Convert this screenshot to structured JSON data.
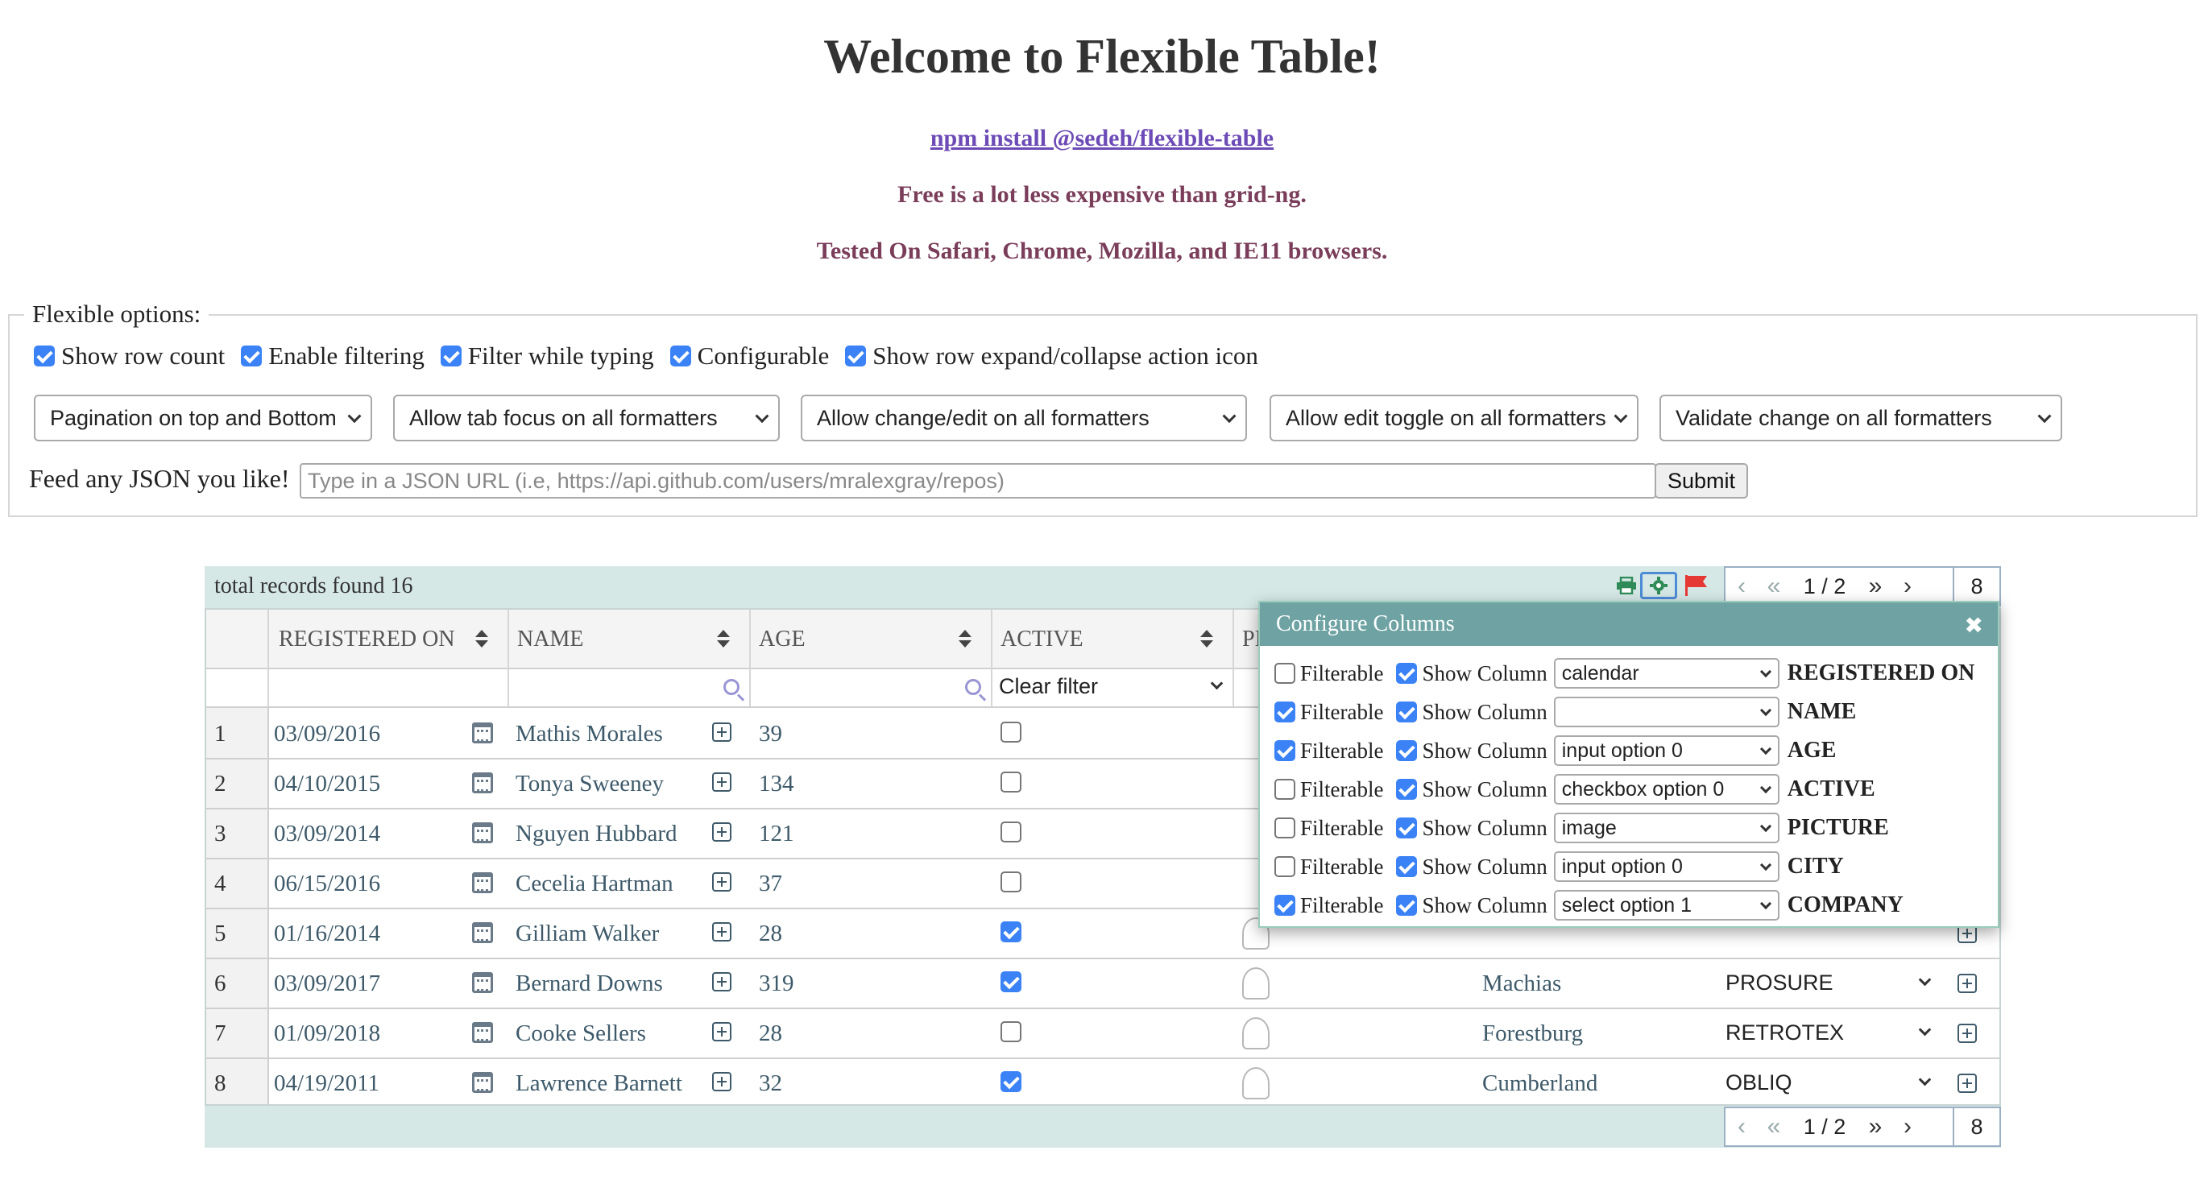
{
  "header": {
    "title": "Welcome to Flexible Table!",
    "install_link": "npm install @sedeh/flexible-table",
    "tagline1": "Free is a lot less expensive than grid-ng.",
    "tagline2": "Tested On Safari, Chrome, Mozilla, and IE11 browsers."
  },
  "options": {
    "legend": "Flexible options:",
    "checkboxes": [
      {
        "label": "Show row count",
        "checked": true
      },
      {
        "label": "Enable filtering",
        "checked": true
      },
      {
        "label": "Filter while typing",
        "checked": true
      },
      {
        "label": "Configurable",
        "checked": true
      },
      {
        "label": "Show row expand/collapse action icon",
        "checked": true
      }
    ],
    "selects": [
      "Pagination on top and Bottom",
      "Allow tab focus on all formatters",
      "Allow change/edit on all formatters",
      "Allow edit toggle on all formatters",
      "Validate change on all formatters"
    ],
    "feed_label": "Feed any JSON you like!",
    "feed_placeholder": "Type in a JSON URL (i.e, https://api.github.com/users/mralexgray/repos)",
    "submit_label": "Submit"
  },
  "table": {
    "total_text": "total records found 16",
    "columns": [
      "REGISTERED ON",
      "NAME",
      "AGE",
      "ACTIVE",
      "PI"
    ],
    "clear_filter": "Clear filter",
    "pager": {
      "page": "1",
      "of": "/ 2",
      "size": "8"
    },
    "rows": [
      {
        "n": "1",
        "date": "03/09/2016",
        "name": "Mathis Morales",
        "age": "39",
        "active": false,
        "city": "",
        "company": ""
      },
      {
        "n": "2",
        "date": "04/10/2015",
        "name": "Tonya Sweeney",
        "age": "134",
        "active": false,
        "city": "",
        "company": ""
      },
      {
        "n": "3",
        "date": "03/09/2014",
        "name": "Nguyen Hubbard",
        "age": "121",
        "active": false,
        "city": "",
        "company": ""
      },
      {
        "n": "4",
        "date": "06/15/2016",
        "name": "Cecelia Hartman",
        "age": "37",
        "active": false,
        "city": "",
        "company": ""
      },
      {
        "n": "5",
        "date": "01/16/2014",
        "name": "Gilliam Walker",
        "age": "28",
        "active": true,
        "city": "",
        "company": ""
      },
      {
        "n": "6",
        "date": "03/09/2017",
        "name": "Bernard Downs",
        "age": "319",
        "active": true,
        "city": "Machias",
        "company": "PROSURE"
      },
      {
        "n": "7",
        "date": "01/09/2018",
        "name": "Cooke Sellers",
        "age": "28",
        "active": false,
        "city": "Forestburg",
        "company": "RETROTEX"
      },
      {
        "n": "8",
        "date": "04/19/2011",
        "name": "Lawrence Barnett",
        "age": "32",
        "active": true,
        "city": "Cumberland",
        "company": "OBLIQ"
      }
    ]
  },
  "configure": {
    "title": "Configure Columns",
    "filterable_label": "Filterable",
    "show_label": "Show Column",
    "rows": [
      {
        "filterable": false,
        "show": true,
        "formatter": "calendar",
        "name": "REGISTERED ON"
      },
      {
        "filterable": true,
        "show": true,
        "formatter": "",
        "name": "NAME"
      },
      {
        "filterable": true,
        "show": true,
        "formatter": "input option 0",
        "name": "AGE"
      },
      {
        "filterable": false,
        "show": true,
        "formatter": "checkbox option 0",
        "name": "ACTIVE"
      },
      {
        "filterable": false,
        "show": true,
        "formatter": "image",
        "name": "PICTURE"
      },
      {
        "filterable": false,
        "show": true,
        "formatter": "input option 0",
        "name": "CITY"
      },
      {
        "filterable": true,
        "show": true,
        "formatter": "select option 1",
        "name": "COMPANY"
      }
    ]
  },
  "colors": {
    "accent": "#3b82f6",
    "tag": "#7a3d5a",
    "link": "#6c4bb6",
    "bar": "#d5e8e6",
    "panel_head": "#6fa3a3"
  }
}
